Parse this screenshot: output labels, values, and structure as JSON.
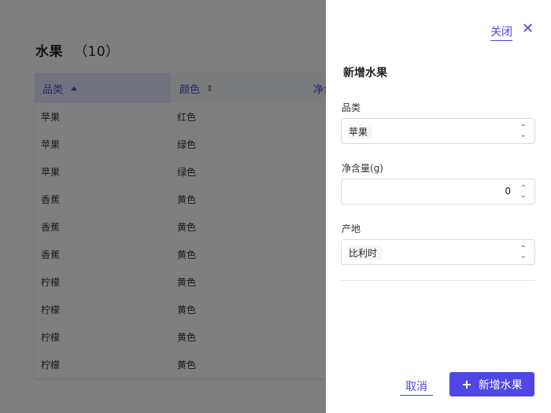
{
  "page": {
    "title": "水果",
    "count": "（10）"
  },
  "table": {
    "columns": [
      {
        "label": "品类",
        "sort": "ascending"
      },
      {
        "label": "颜色",
        "sort": "none"
      },
      {
        "label": "净含"
      }
    ],
    "rows": [
      [
        "苹果",
        "红色"
      ],
      [
        "苹果",
        "绿色"
      ],
      [
        "苹果",
        "绿色"
      ],
      [
        "香蕉",
        "黄色"
      ],
      [
        "香蕉",
        "黄色"
      ],
      [
        "香蕉",
        "黄色"
      ],
      [
        "柠檬",
        "黄色"
      ],
      [
        "柠檬",
        "黄色"
      ],
      [
        "柠檬",
        "黄色"
      ],
      [
        "柠檬",
        "黄色"
      ]
    ]
  },
  "drawer": {
    "close_label": "关闭",
    "close_icon": "✕",
    "title": "新增水果",
    "fields": {
      "category": {
        "label": "品类",
        "value": "苹果"
      },
      "weight": {
        "label": "净含量(g)",
        "value": "0"
      },
      "origin": {
        "label": "产地",
        "value": "比利时"
      }
    },
    "cancel_label": "取消",
    "submit_label": "新增水果",
    "submit_icon": "+"
  },
  "colors": {
    "accent": "#4f46e5",
    "overlay": "rgba(0,0,0,0.5)"
  }
}
